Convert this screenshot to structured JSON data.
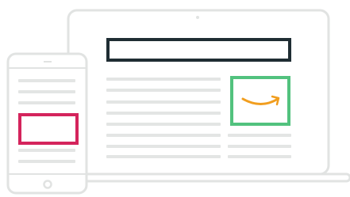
{
  "illustration": {
    "colors": {
      "outline": "#e1e3e2",
      "text_lines": "#e3e5e4",
      "banner_border": "#1f2d33",
      "ad_border_green": "#52c27e",
      "ad_border_pink": "#d4245c",
      "smile": "#f19e1f",
      "background": "#ffffff"
    },
    "icons": {
      "laptop": "laptop-icon",
      "phone": "phone-icon",
      "logo_mark": "smile-arrow-logo"
    }
  }
}
